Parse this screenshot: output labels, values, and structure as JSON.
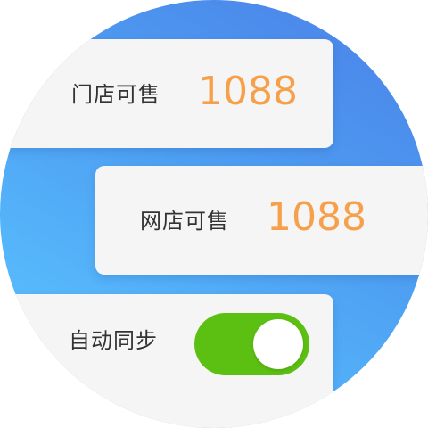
{
  "store_stock": {
    "label": "门店可售",
    "value": "1088"
  },
  "online_stock": {
    "label": "网店可售",
    "value": "1088"
  },
  "auto_sync": {
    "label": "自动同步",
    "enabled": true
  },
  "colors": {
    "background_gradient_start": "#4b80e8",
    "background_gradient_end": "#5cc0ff",
    "card_background": "#f5f5f5",
    "value_color": "#f7a04b",
    "label_color": "#333333",
    "toggle_on": "#5cc013",
    "toggle_knob": "#ffffff"
  }
}
